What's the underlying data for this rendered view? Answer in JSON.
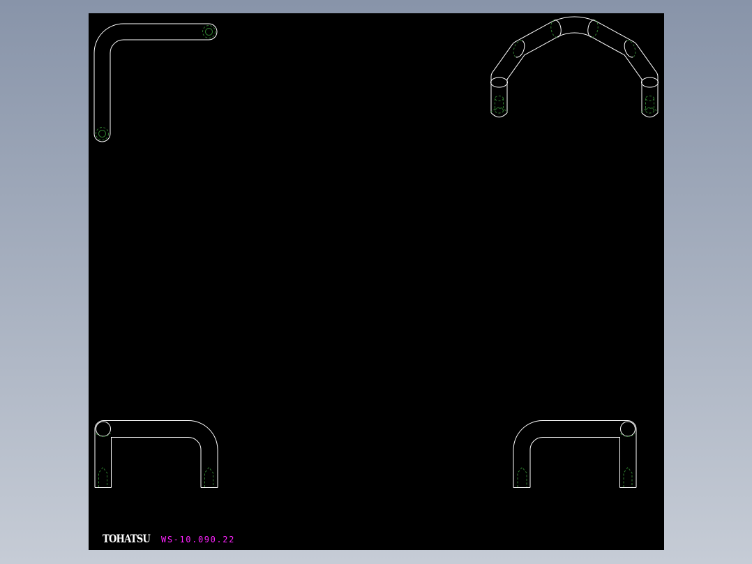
{
  "colors": {
    "bg-top": "#8894a9",
    "bg-bottom": "#c6ccd6",
    "canvas-bg": "#000000",
    "line": "#ffffff",
    "hidden": "#2e7d2e",
    "accent": "#ff22ff"
  },
  "footer": {
    "logo_text": "TOHATSU",
    "drawing_number": "WS-10.090.22"
  }
}
